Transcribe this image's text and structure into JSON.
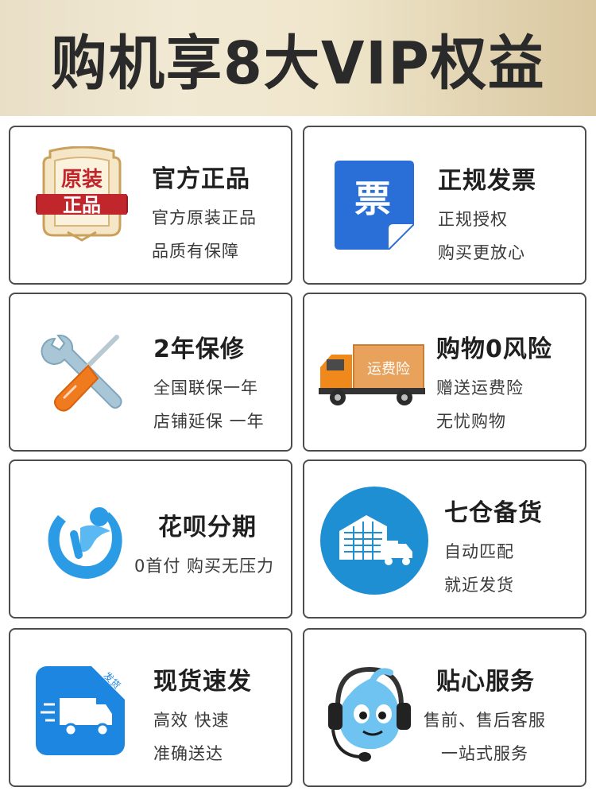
{
  "header": {
    "title": "购机享8大VIP权益"
  },
  "cards": [
    {
      "title": "官方正品",
      "lines": [
        "官方原装正品",
        "品质有保障"
      ],
      "badge_text": [
        "原装",
        "正品"
      ],
      "icon": "genuine-badge-icon"
    },
    {
      "title": "正规发票",
      "lines": [
        "正规授权",
        "购买更放心"
      ],
      "badge_text": [
        "票"
      ],
      "icon": "invoice-icon"
    },
    {
      "title": "2年保修",
      "lines": [
        "全国联保一年",
        "店铺延保 一年"
      ],
      "icon": "wrench-screwdriver-icon"
    },
    {
      "title": "购物0风险",
      "lines": [
        "赠送运费险",
        "无忧购物"
      ],
      "badge_text": [
        "运费险"
      ],
      "icon": "delivery-truck-icon"
    },
    {
      "title": "花呗分期",
      "lines": [
        "0首付 购买无压力"
      ],
      "icon": "huabei-icon"
    },
    {
      "title": "七仓备货",
      "lines": [
        "自动匹配",
        "就近发货"
      ],
      "icon": "warehouse-icon"
    },
    {
      "title": "现货速发",
      "lines": [
        "高效 快速",
        "准确送达"
      ],
      "badge_text": [
        "发货"
      ],
      "icon": "fast-shipping-icon"
    },
    {
      "title": "贴心服务",
      "lines": [
        "售前、售后客服",
        "一站式服务"
      ],
      "icon": "customer-service-icon"
    }
  ],
  "colors": {
    "banner_gold": "#e9dfc7",
    "card_border": "#4d4d4d",
    "invoice_blue": "#2a6fd8",
    "truck_orange": "#f0891c",
    "service_blue": "#2f8fd6",
    "ribbon_red": "#c0262c"
  }
}
